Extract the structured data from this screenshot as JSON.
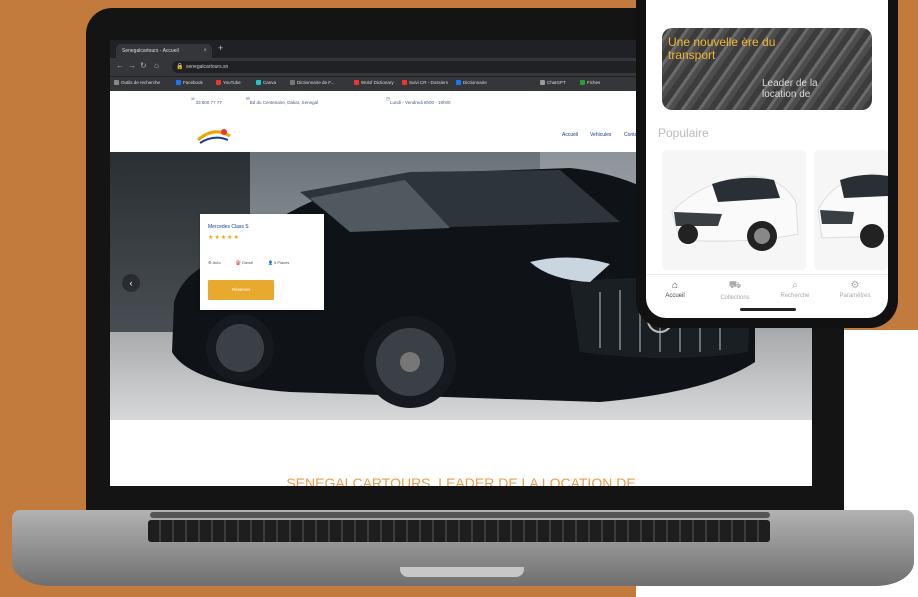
{
  "browser": {
    "tab_title": "Senegalcartours - Accueil",
    "tab_close": "×",
    "new_tab": "+",
    "url": "senegalcartours.sn",
    "bookmarks": [
      "Outils de recherche",
      "Facebook",
      "YouTube",
      "Canva",
      "Dictionnaire de F...",
      "Wolof Dictionary",
      "Suivi CR - Dossiers",
      "Dictionnaire",
      "ChatGPT",
      "Fiches"
    ]
  },
  "site": {
    "top_phone": "33 800 77 77",
    "top_address": "Bd du Centenaire, Dakar, Senegal",
    "top_hours": "Lundi - Vendredi 8h00 - 18h00",
    "menu": [
      "Accueil",
      "Vehicules",
      "Contact"
    ],
    "hero_prev": "‹",
    "card": {
      "title": "Mercedes Class S",
      "stars": "★★★★★",
      "features": [
        "Auto",
        "Diesel",
        "5 Places"
      ],
      "button": "Réserver"
    },
    "headline": "SENEGALCARTOURS, LEADER DE LA LOCATION DE"
  },
  "phone": {
    "promo_line1": "Une nouvelle ère du transport",
    "promo_line2": "Leader de la location de",
    "section_title": "Populaire",
    "nav": [
      {
        "label": "Accueil",
        "icon": "home-icon",
        "glyph": "⌂"
      },
      {
        "label": "Collections",
        "icon": "car-icon",
        "glyph": "⛟"
      },
      {
        "label": "Recherche",
        "icon": "search-icon",
        "glyph": "⌕"
      },
      {
        "label": "Paramètres",
        "icon": "settings-icon",
        "glyph": "⚙"
      }
    ]
  },
  "colors": {
    "background": "#c27a3d",
    "accent_orange": "#e8a92f",
    "brand_blue": "#1a3c8f",
    "headline_orange": "#e89c4b"
  }
}
